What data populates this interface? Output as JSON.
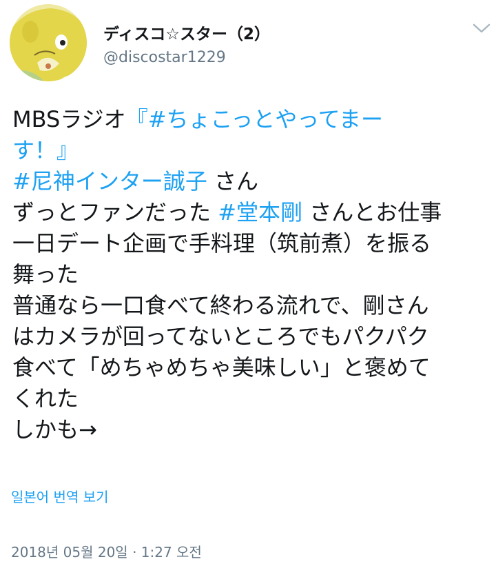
{
  "user": {
    "display_name": "ディスコ☆スター（2）",
    "handle": "@discostar1229"
  },
  "icons": {
    "avatar": "mascot-avatar",
    "menu": "chevron-down-icon"
  },
  "tweet": {
    "line1_prefix": "MBSラジオ",
    "line1_link": "『#ちょこっとやってまー",
    "line2_link": "す！』",
    "line3_link": "#尼神インター誠子",
    "line3_suffix": " さん",
    "line4_prefix": "ずっとファンだった ",
    "line4_link": "#堂本剛",
    "line4_suffix": " さんとお仕事",
    "line5": "一日デート企画で手料理（筑前煮）を振る",
    "line6": "舞った",
    "line7": "普通なら一口食べて終わる流れで、剛さん",
    "line8": "はカメラが回ってないところでもパクパク",
    "line9": "食べて「めちゃめちゃ美味しい」と褒めて",
    "line10": "くれた",
    "line11": "しかも→"
  },
  "translate_label": "일본어 번역 보기",
  "timestamp": "2018년 05월 20일 · 1:27 오전",
  "colors": {
    "link": "#1da1f2",
    "text": "#14171a",
    "secondary": "#657786"
  }
}
